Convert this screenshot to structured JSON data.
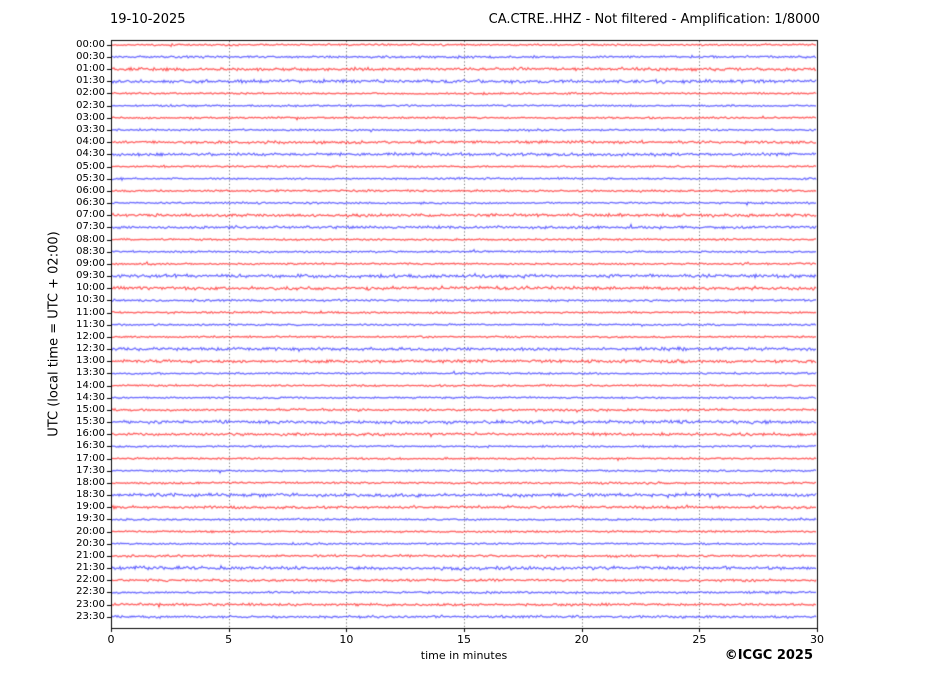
{
  "header": {
    "date": "19-10-2025",
    "title": "CA.CTRE..HHZ - Not filtered - Amplification: 1/8000"
  },
  "footer": {
    "credit": "©ICGC 2025"
  },
  "chart_data": {
    "type": "line",
    "subtype": "helicorder-seismogram",
    "station": "CA.CTRE..HHZ",
    "filter": "Not filtered",
    "amplification": "1/8000",
    "date": "19-10-2025",
    "xlabel": "time in minutes",
    "ylabel": "UTC (local time = UTC + 02:00)",
    "xlim": [
      0,
      30
    ],
    "x_ticks": [
      0,
      5,
      10,
      15,
      20,
      25,
      30
    ],
    "minutes_per_row": 30,
    "grid": {
      "vertical_dotted_minutes": [
        5,
        10,
        15,
        20,
        25
      ],
      "color": "#777777",
      "style": "dotted"
    },
    "colors": {
      "hour_trace": "#ff1a1a",
      "half_hour_trace": "#2b2bff",
      "frame": "#000000",
      "text": "#000000",
      "background": "#ffffff"
    },
    "legend_position": "none",
    "rows": [
      {
        "label": "00:00",
        "color": "hour",
        "amplitude": 1.0
      },
      {
        "label": "00:30",
        "color": "half",
        "amplitude": 1.2
      },
      {
        "label": "01:00",
        "color": "hour",
        "amplitude": 1.6
      },
      {
        "label": "01:30",
        "color": "half",
        "amplitude": 1.7
      },
      {
        "label": "02:00",
        "color": "hour",
        "amplitude": 1.0
      },
      {
        "label": "02:30",
        "color": "half",
        "amplitude": 1.0
      },
      {
        "label": "03:00",
        "color": "hour",
        "amplitude": 1.0
      },
      {
        "label": "03:30",
        "color": "half",
        "amplitude": 1.0
      },
      {
        "label": "04:00",
        "color": "hour",
        "amplitude": 1.5
      },
      {
        "label": "04:30",
        "color": "half",
        "amplitude": 1.6
      },
      {
        "label": "05:00",
        "color": "hour",
        "amplitude": 1.0
      },
      {
        "label": "05:30",
        "color": "half",
        "amplitude": 1.0
      },
      {
        "label": "06:00",
        "color": "hour",
        "amplitude": 1.1
      },
      {
        "label": "06:30",
        "color": "half",
        "amplitude": 1.0
      },
      {
        "label": "07:00",
        "color": "hour",
        "amplitude": 1.6
      },
      {
        "label": "07:30",
        "color": "half",
        "amplitude": 1.5
      },
      {
        "label": "08:00",
        "color": "hour",
        "amplitude": 1.0
      },
      {
        "label": "08:30",
        "color": "half",
        "amplitude": 1.0
      },
      {
        "label": "09:00",
        "color": "hour",
        "amplitude": 1.0
      },
      {
        "label": "09:30",
        "color": "half",
        "amplitude": 1.7
      },
      {
        "label": "10:00",
        "color": "hour",
        "amplitude": 1.7
      },
      {
        "label": "10:30",
        "color": "half",
        "amplitude": 1.1
      },
      {
        "label": "11:00",
        "color": "hour",
        "amplitude": 1.0
      },
      {
        "label": "11:30",
        "color": "half",
        "amplitude": 1.0
      },
      {
        "label": "12:00",
        "color": "hour",
        "amplitude": 1.0
      },
      {
        "label": "12:30",
        "color": "half",
        "amplitude": 1.7
      },
      {
        "label": "13:00",
        "color": "hour",
        "amplitude": 1.6
      },
      {
        "label": "13:30",
        "color": "half",
        "amplitude": 1.0
      },
      {
        "label": "14:00",
        "color": "hour",
        "amplitude": 1.0
      },
      {
        "label": "14:30",
        "color": "half",
        "amplitude": 1.0
      },
      {
        "label": "15:00",
        "color": "hour",
        "amplitude": 1.2
      },
      {
        "label": "15:30",
        "color": "half",
        "amplitude": 1.7
      },
      {
        "label": "16:00",
        "color": "hour",
        "amplitude": 1.5
      },
      {
        "label": "16:30",
        "color": "half",
        "amplitude": 1.0
      },
      {
        "label": "17:00",
        "color": "hour",
        "amplitude": 1.0
      },
      {
        "label": "17:30",
        "color": "half",
        "amplitude": 1.0
      },
      {
        "label": "18:00",
        "color": "hour",
        "amplitude": 1.1
      },
      {
        "label": "18:30",
        "color": "half",
        "amplitude": 1.8
      },
      {
        "label": "19:00",
        "color": "hour",
        "amplitude": 1.4
      },
      {
        "label": "19:30",
        "color": "half",
        "amplitude": 1.0
      },
      {
        "label": "20:00",
        "color": "hour",
        "amplitude": 1.0
      },
      {
        "label": "20:30",
        "color": "half",
        "amplitude": 1.0
      },
      {
        "label": "21:00",
        "color": "hour",
        "amplitude": 1.2
      },
      {
        "label": "21:30",
        "color": "half",
        "amplitude": 1.8
      },
      {
        "label": "22:00",
        "color": "hour",
        "amplitude": 1.3
      },
      {
        "label": "22:30",
        "color": "half",
        "amplitude": 1.1
      },
      {
        "label": "23:00",
        "color": "hour",
        "amplitude": 1.3
      },
      {
        "label": "23:30",
        "color": "half",
        "amplitude": 1.3
      }
    ]
  }
}
